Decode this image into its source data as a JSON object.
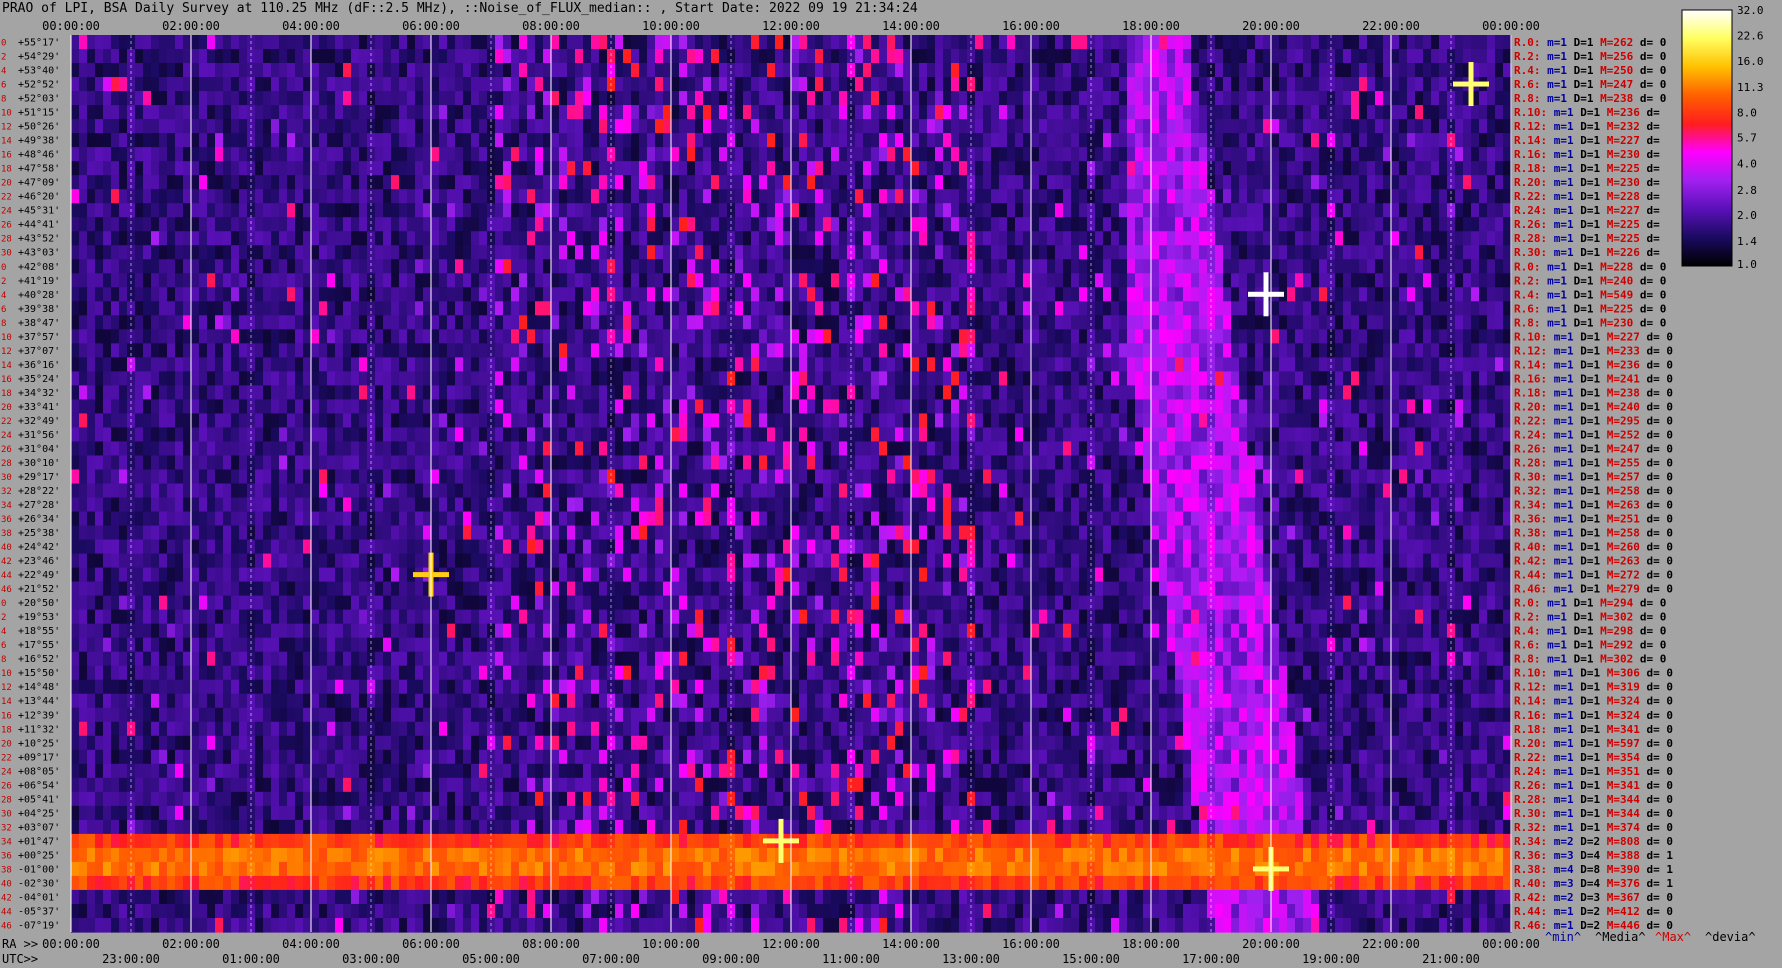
{
  "title": "PRAO of LPI, BSA Daily Survey at 110.25 MHz (dF::2.5 MHz), ::Noise_of_FLUX_median:: , Start Date: 2022 09 19 21:34:24",
  "chart_data": {
    "type": "heatmap",
    "title": "PRAO of LPI, BSA Daily Survey at 110.25 MHz (dF::2.5 MHz), ::Noise_of_FLUX_median:: , Start Date: 2022 09 19 21:34:24",
    "x_top_ticks": [
      "00:00:00",
      "02:00:00",
      "04:00:00",
      "06:00:00",
      "08:00:00",
      "10:00:00",
      "12:00:00",
      "14:00:00",
      "16:00:00",
      "18:00:00",
      "20:00:00",
      "22:00:00",
      "00:00:00"
    ],
    "x_ra_prefix": "RA >>",
    "x_ra_ticks": [
      "00:00:00",
      "02:00:00",
      "04:00:00",
      "06:00:00",
      "08:00:00",
      "10:00:00",
      "12:00:00",
      "14:00:00",
      "16:00:00",
      "18:00:00",
      "20:00:00",
      "22:00:00",
      "00:00:00"
    ],
    "x_utc_prefix": "UTC>>",
    "x_utc_ticks": [
      "23:00:00",
      "01:00:00",
      "03:00:00",
      "05:00:00",
      "07:00:00",
      "09:00:00",
      "11:00:00",
      "13:00:00",
      "15:00:00",
      "17:00:00",
      "19:00:00",
      "21:00:00"
    ],
    "row_index_labels": [
      "0",
      "2",
      "4",
      "6",
      "8",
      "10",
      "12",
      "14",
      "16",
      "18",
      "20",
      "22",
      "24",
      "26",
      "28",
      "30",
      "0",
      "2",
      "4",
      "6",
      "8",
      "10",
      "12",
      "14",
      "16",
      "18",
      "20",
      "22",
      "24",
      "26",
      "28",
      "30",
      "32",
      "34",
      "36",
      "38",
      "40",
      "42",
      "44",
      "46",
      "0",
      "2",
      "4",
      "6",
      "8",
      "10",
      "12",
      "14",
      "16",
      "18",
      "20",
      "22",
      "24",
      "26",
      "28",
      "30",
      "32",
      "34",
      "36",
      "38",
      "40",
      "42",
      "44",
      "46"
    ],
    "declinations": [
      "+55°17'",
      "+54°29'",
      "+53°40'",
      "+52°52'",
      "+52°03'",
      "+51°15'",
      "+50°26'",
      "+49°38'",
      "+48°46'",
      "+47°58'",
      "+47°09'",
      "+46°20'",
      "+45°31'",
      "+44°41'",
      "+43°52'",
      "+43°03'",
      "+42°08'",
      "+41°19'",
      "+40°28'",
      "+39°38'",
      "+38°47'",
      "+37°57'",
      "+37°07'",
      "+36°16'",
      "+35°24'",
      "+34°32'",
      "+33°41'",
      "+32°49'",
      "+31°56'",
      "+31°04'",
      "+30°10'",
      "+29°17'",
      "+28°22'",
      "+27°28'",
      "+26°34'",
      "+25°38'",
      "+24°42'",
      "+23°46'",
      "+22°49'",
      "+21°52'",
      "+20°50'",
      "+19°53'",
      "+18°55'",
      "+17°55'",
      "+16°52'",
      "+15°50'",
      "+14°48'",
      "+13°44'",
      "+12°39'",
      "+11°32'",
      "+10°25'",
      "+09°17'",
      "+08°05'",
      "+06°54'",
      "+05°41'",
      "+04°25'",
      "+03°07'",
      "+01°47'",
      "+00°25'",
      "-01°00'",
      "-02°30'",
      "-04°01'",
      "-05°37'",
      "-07°19'"
    ],
    "row_stats": [
      {
        "r": "R.0:",
        "m": "m=1",
        "d": "D=1",
        "M": "M=262",
        "dv": "d= 0"
      },
      {
        "r": "R.2:",
        "m": "m=1",
        "d": "D=1",
        "M": "M=256",
        "dv": "d= 0"
      },
      {
        "r": "R.4:",
        "m": "m=1",
        "d": "D=1",
        "M": "M=250",
        "dv": "d= 0"
      },
      {
        "r": "R.6:",
        "m": "m=1",
        "d": "D=1",
        "M": "M=247",
        "dv": "d= 0"
      },
      {
        "r": "R.8:",
        "m": "m=1",
        "d": "D=1",
        "M": "M=238",
        "dv": "d= 0"
      },
      {
        "r": "R.10:",
        "m": "m=1",
        "d": "D=1",
        "M": "M=236",
        "dv": "d="
      },
      {
        "r": "R.12:",
        "m": "m=1",
        "d": "D=1",
        "M": "M=232",
        "dv": "d="
      },
      {
        "r": "R.14:",
        "m": "m=1",
        "d": "D=1",
        "M": "M=227",
        "dv": "d="
      },
      {
        "r": "R.16:",
        "m": "m=1",
        "d": "D=1",
        "M": "M=230",
        "dv": "d="
      },
      {
        "r": "R.18:",
        "m": "m=1",
        "d": "D=1",
        "M": "M=225",
        "dv": "d="
      },
      {
        "r": "R.20:",
        "m": "m=1",
        "d": "D=1",
        "M": "M=230",
        "dv": "d="
      },
      {
        "r": "R.22:",
        "m": "m=1",
        "d": "D=1",
        "M": "M=228",
        "dv": "d="
      },
      {
        "r": "R.24:",
        "m": "m=1",
        "d": "D=1",
        "M": "M=227",
        "dv": "d="
      },
      {
        "r": "R.26:",
        "m": "m=1",
        "d": "D=1",
        "M": "M=225",
        "dv": "d="
      },
      {
        "r": "R.28:",
        "m": "m=1",
        "d": "D=1",
        "M": "M=225",
        "dv": "d="
      },
      {
        "r": "R.30:",
        "m": "m=1",
        "d": "D=1",
        "M": "M=226",
        "dv": "d="
      },
      {
        "r": "R.0:",
        "m": "m=1",
        "d": "D=1",
        "M": "M=228",
        "dv": "d= 0"
      },
      {
        "r": "R.2:",
        "m": "m=1",
        "d": "D=1",
        "M": "M=240",
        "dv": "d= 0"
      },
      {
        "r": "R.4:",
        "m": "m=1",
        "d": "D=1",
        "M": "M=549",
        "dv": "d= 0"
      },
      {
        "r": "R.6:",
        "m": "m=1",
        "d": "D=1",
        "M": "M=225",
        "dv": "d= 0"
      },
      {
        "r": "R.8:",
        "m": "m=1",
        "d": "D=1",
        "M": "M=230",
        "dv": "d= 0"
      },
      {
        "r": "R.10:",
        "m": "m=1",
        "d": "D=1",
        "M": "M=227",
        "dv": "d= 0"
      },
      {
        "r": "R.12:",
        "m": "m=1",
        "d": "D=1",
        "M": "M=233",
        "dv": "d= 0"
      },
      {
        "r": "R.14:",
        "m": "m=1",
        "d": "D=1",
        "M": "M=236",
        "dv": "d= 0"
      },
      {
        "r": "R.16:",
        "m": "m=1",
        "d": "D=1",
        "M": "M=241",
        "dv": "d= 0"
      },
      {
        "r": "R.18:",
        "m": "m=1",
        "d": "D=1",
        "M": "M=238",
        "dv": "d= 0"
      },
      {
        "r": "R.20:",
        "m": "m=1",
        "d": "D=1",
        "M": "M=240",
        "dv": "d= 0"
      },
      {
        "r": "R.22:",
        "m": "m=1",
        "d": "D=1",
        "M": "M=295",
        "dv": "d= 0"
      },
      {
        "r": "R.24:",
        "m": "m=1",
        "d": "D=1",
        "M": "M=252",
        "dv": "d= 0"
      },
      {
        "r": "R.26:",
        "m": "m=1",
        "d": "D=1",
        "M": "M=247",
        "dv": "d= 0"
      },
      {
        "r": "R.28:",
        "m": "m=1",
        "d": "D=1",
        "M": "M=255",
        "dv": "d= 0"
      },
      {
        "r": "R.30:",
        "m": "m=1",
        "d": "D=1",
        "M": "M=257",
        "dv": "d= 0"
      },
      {
        "r": "R.32:",
        "m": "m=1",
        "d": "D=1",
        "M": "M=258",
        "dv": "d= 0"
      },
      {
        "r": "R.34:",
        "m": "m=1",
        "d": "D=1",
        "M": "M=263",
        "dv": "d= 0"
      },
      {
        "r": "R.36:",
        "m": "m=1",
        "d": "D=1",
        "M": "M=251",
        "dv": "d= 0"
      },
      {
        "r": "R.38:",
        "m": "m=1",
        "d": "D=1",
        "M": "M=258",
        "dv": "d= 0"
      },
      {
        "r": "R.40:",
        "m": "m=1",
        "d": "D=1",
        "M": "M=260",
        "dv": "d= 0"
      },
      {
        "r": "R.42:",
        "m": "m=1",
        "d": "D=1",
        "M": "M=263",
        "dv": "d= 0"
      },
      {
        "r": "R.44:",
        "m": "m=1",
        "d": "D=1",
        "M": "M=272",
        "dv": "d= 0"
      },
      {
        "r": "R.46:",
        "m": "m=1",
        "d": "D=1",
        "M": "M=279",
        "dv": "d= 0"
      },
      {
        "r": "R.0:",
        "m": "m=1",
        "d": "D=1",
        "M": "M=294",
        "dv": "d= 0"
      },
      {
        "r": "R.2:",
        "m": "m=1",
        "d": "D=1",
        "M": "M=302",
        "dv": "d= 0"
      },
      {
        "r": "R.4:",
        "m": "m=1",
        "d": "D=1",
        "M": "M=298",
        "dv": "d= 0"
      },
      {
        "r": "R.6:",
        "m": "m=1",
        "d": "D=1",
        "M": "M=292",
        "dv": "d= 0"
      },
      {
        "r": "R.8:",
        "m": "m=1",
        "d": "D=1",
        "M": "M=302",
        "dv": "d= 0"
      },
      {
        "r": "R.10:",
        "m": "m=1",
        "d": "D=1",
        "M": "M=306",
        "dv": "d= 0"
      },
      {
        "r": "R.12:",
        "m": "m=1",
        "d": "D=1",
        "M": "M=319",
        "dv": "d= 0"
      },
      {
        "r": "R.14:",
        "m": "m=1",
        "d": "D=1",
        "M": "M=324",
        "dv": "d= 0"
      },
      {
        "r": "R.16:",
        "m": "m=1",
        "d": "D=1",
        "M": "M=324",
        "dv": "d= 0"
      },
      {
        "r": "R.18:",
        "m": "m=1",
        "d": "D=1",
        "M": "M=341",
        "dv": "d= 0"
      },
      {
        "r": "R.20:",
        "m": "m=1",
        "d": "D=1",
        "M": "M=597",
        "dv": "d= 0"
      },
      {
        "r": "R.22:",
        "m": "m=1",
        "d": "D=1",
        "M": "M=354",
        "dv": "d= 0"
      },
      {
        "r": "R.24:",
        "m": "m=1",
        "d": "D=1",
        "M": "M=351",
        "dv": "d= 0"
      },
      {
        "r": "R.26:",
        "m": "m=1",
        "d": "D=1",
        "M": "M=341",
        "dv": "d= 0"
      },
      {
        "r": "R.28:",
        "m": "m=1",
        "d": "D=1",
        "M": "M=344",
        "dv": "d= 0"
      },
      {
        "r": "R.30:",
        "m": "m=1",
        "d": "D=1",
        "M": "M=344",
        "dv": "d= 0"
      },
      {
        "r": "R.32:",
        "m": "m=1",
        "d": "D=1",
        "M": "M=374",
        "dv": "d= 0"
      },
      {
        "r": "R.34:",
        "m": "m=2",
        "d": "D=2",
        "M": "M=808",
        "dv": "d= 0"
      },
      {
        "r": "R.36:",
        "m": "m=3",
        "d": "D=4",
        "M": "M=388",
        "dv": "d= 1"
      },
      {
        "r": "R.38:",
        "m": "m=4",
        "d": "D=8",
        "M": "M=390",
        "dv": "d= 1"
      },
      {
        "r": "R.40:",
        "m": "m=3",
        "d": "D=4",
        "M": "M=376",
        "dv": "d= 1"
      },
      {
        "r": "R.42:",
        "m": "m=2",
        "d": "D=3",
        "M": "M=367",
        "dv": "d= 0"
      },
      {
        "r": "R.44:",
        "m": "m=1",
        "d": "D=2",
        "M": "M=412",
        "dv": "d= 0"
      },
      {
        "r": "R.46:",
        "m": "m=1",
        "d": "D=2",
        "M": "M=446",
        "dv": "d= 0"
      }
    ],
    "legend_labels": [
      "^min^",
      "^Media^",
      "^Max^",
      "^devia^"
    ],
    "colorbar_ticks": [
      32.0,
      22.6,
      16.0,
      11.3,
      8.0,
      5.7,
      4.0,
      2.8,
      2.0,
      1.4,
      1.0
    ],
    "colorbar_labels": [
      "32.0",
      "22.6",
      "16.0",
      "11.3",
      "8.0",
      "5.7",
      "4.0",
      "2.8",
      "2.0",
      "1.4",
      "1.0"
    ],
    "color_range": [
      1.0,
      32.0
    ],
    "scale": "log",
    "colormap_stops": [
      "#000000",
      "#1a0a60",
      "#5a10b8",
      "#a020f0",
      "#ff00ff",
      "#ff1e1e",
      "#ff6000",
      "#ffc000",
      "#ffff60",
      "#ffffff"
    ],
    "features": [
      {
        "kind": "band",
        "dec_from": "+01°47'",
        "dec_to": "-02°30'",
        "ra_from": "00:00:00",
        "ra_to": "24:00:00",
        "value": 10.0
      },
      {
        "kind": "point",
        "ra": "19:55:00",
        "dec": "+40°28'",
        "value": 32.0
      },
      {
        "kind": "point",
        "ra": "23:20:00",
        "dec": "+52°52'",
        "value": 22.6
      },
      {
        "kind": "point",
        "ra": "06:00:00",
        "dec": "+22°49'",
        "value": 16.0
      },
      {
        "kind": "point",
        "ra": "11:50:00",
        "dec": "+01°47'",
        "value": 22.6
      },
      {
        "kind": "point",
        "ra": "20:00:00",
        "dec": "-01°00'",
        "value": 22.6
      }
    ]
  }
}
